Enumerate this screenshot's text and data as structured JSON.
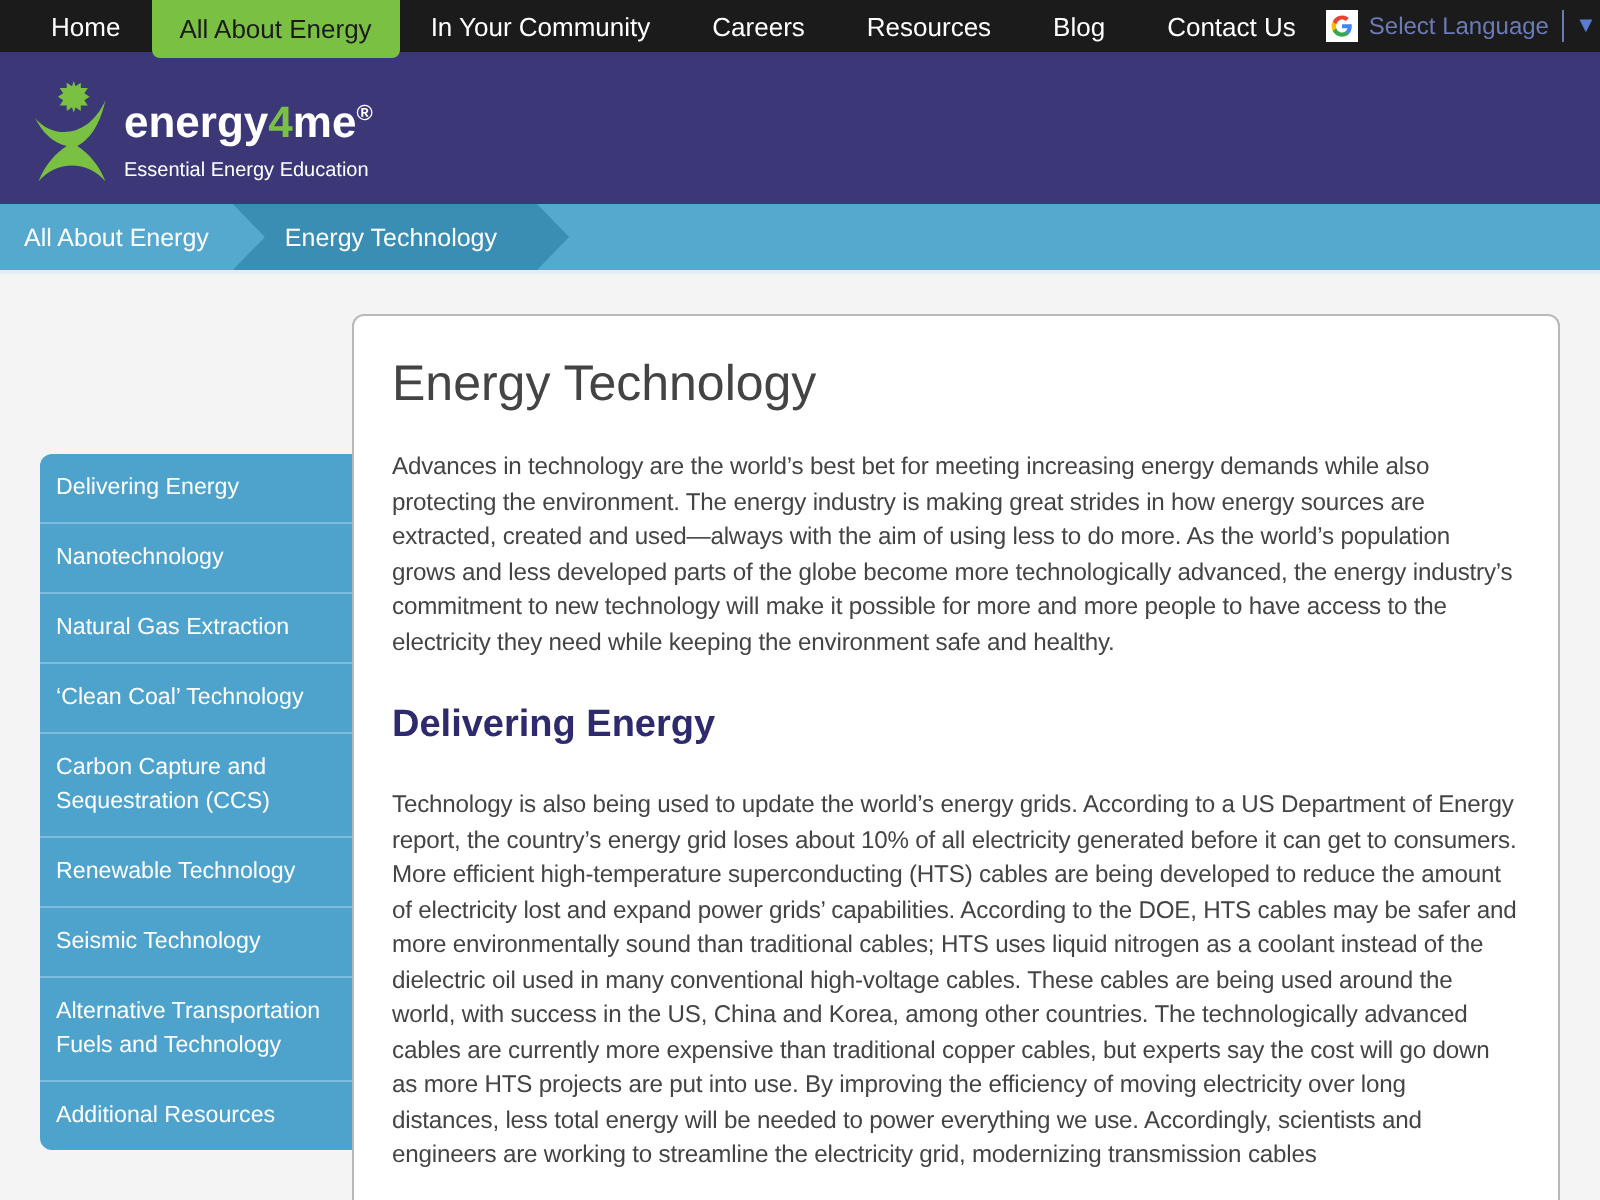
{
  "top_nav": {
    "items": [
      {
        "label": "Home",
        "selected": false
      },
      {
        "label": "All About Energy",
        "selected": true
      },
      {
        "label": "In Your Community",
        "selected": false
      },
      {
        "label": "Careers",
        "selected": false
      },
      {
        "label": "Resources",
        "selected": false
      },
      {
        "label": "Blog",
        "selected": false
      },
      {
        "label": "Contact Us",
        "selected": false
      }
    ],
    "language": {
      "placeholder": "Select Language",
      "caret": "▼"
    }
  },
  "logo": {
    "parts": [
      {
        "text": "energy",
        "accent": false
      },
      {
        "text": "4",
        "accent": true
      },
      {
        "text": "me",
        "accent": false
      }
    ],
    "mark": "®",
    "tagline": "Essential Energy Education"
  },
  "breadcrumb": [
    {
      "label": "All About Energy",
      "selected": false
    },
    {
      "label": "Energy Technology",
      "selected": true
    }
  ],
  "sidebar": {
    "items": [
      {
        "label": "Delivering Energy",
        "selected": false
      },
      {
        "label": "Nanotechnology",
        "selected": false
      },
      {
        "label": "Natural Gas Extraction",
        "selected": false
      },
      {
        "label": "‘Clean Coal’ Technology",
        "selected": false
      },
      {
        "label": "Carbon Capture and Sequestration (CCS)",
        "selected": false
      },
      {
        "label": "Renewable Technology",
        "selected": false
      },
      {
        "label": "Seismic Technology",
        "selected": false
      },
      {
        "label": "Alternative Transportation Fuels and Technology",
        "selected": false
      },
      {
        "label": "Additional Resources",
        "selected": false
      }
    ]
  },
  "article": {
    "title": "Energy Technology",
    "intro": "Advances in technology are the world’s best bet for meeting increasing energy demands while also protecting the environment. The energy industry is making great strides in how energy sources are extracted, created and used—always with the aim of using less to do more. As the world’s population grows and less developed parts of the globe become more technologically advanced, the energy industry’s commitment to new technology will make it possible for more and more people to have access to the electricity they need while keeping the environment safe and healthy.",
    "section_heading": "Delivering Energy",
    "section_text": "Technology is also being used to update the world’s energy grids. According to a US Department of Energy report, the country’s energy grid loses about 10% of all electricity generated before it can get to consumers. More efficient high-temperature superconducting (HTS) cables are being developed to reduce the amount of electricity lost and expand power grids’ capabilities. According to the DOE, HTS cables may be safer and more environmentally sound than traditional cables; HTS uses liquid nitrogen as a coolant instead of the dielectric oil used in many conventional high-voltage cables. These cables are being used around the world, with success in the US, China and Korea, among other countries. The technologically advanced cables are currently more expensive than traditional copper cables, but experts say the cost will go down as more HTS projects are put into use. By improving the efficiency of moving electricity over long distances, less total energy will be needed to power everything we use. Accordingly, scientists and engineers are working to streamline the electricity grid, modernizing transmission cables"
  }
}
